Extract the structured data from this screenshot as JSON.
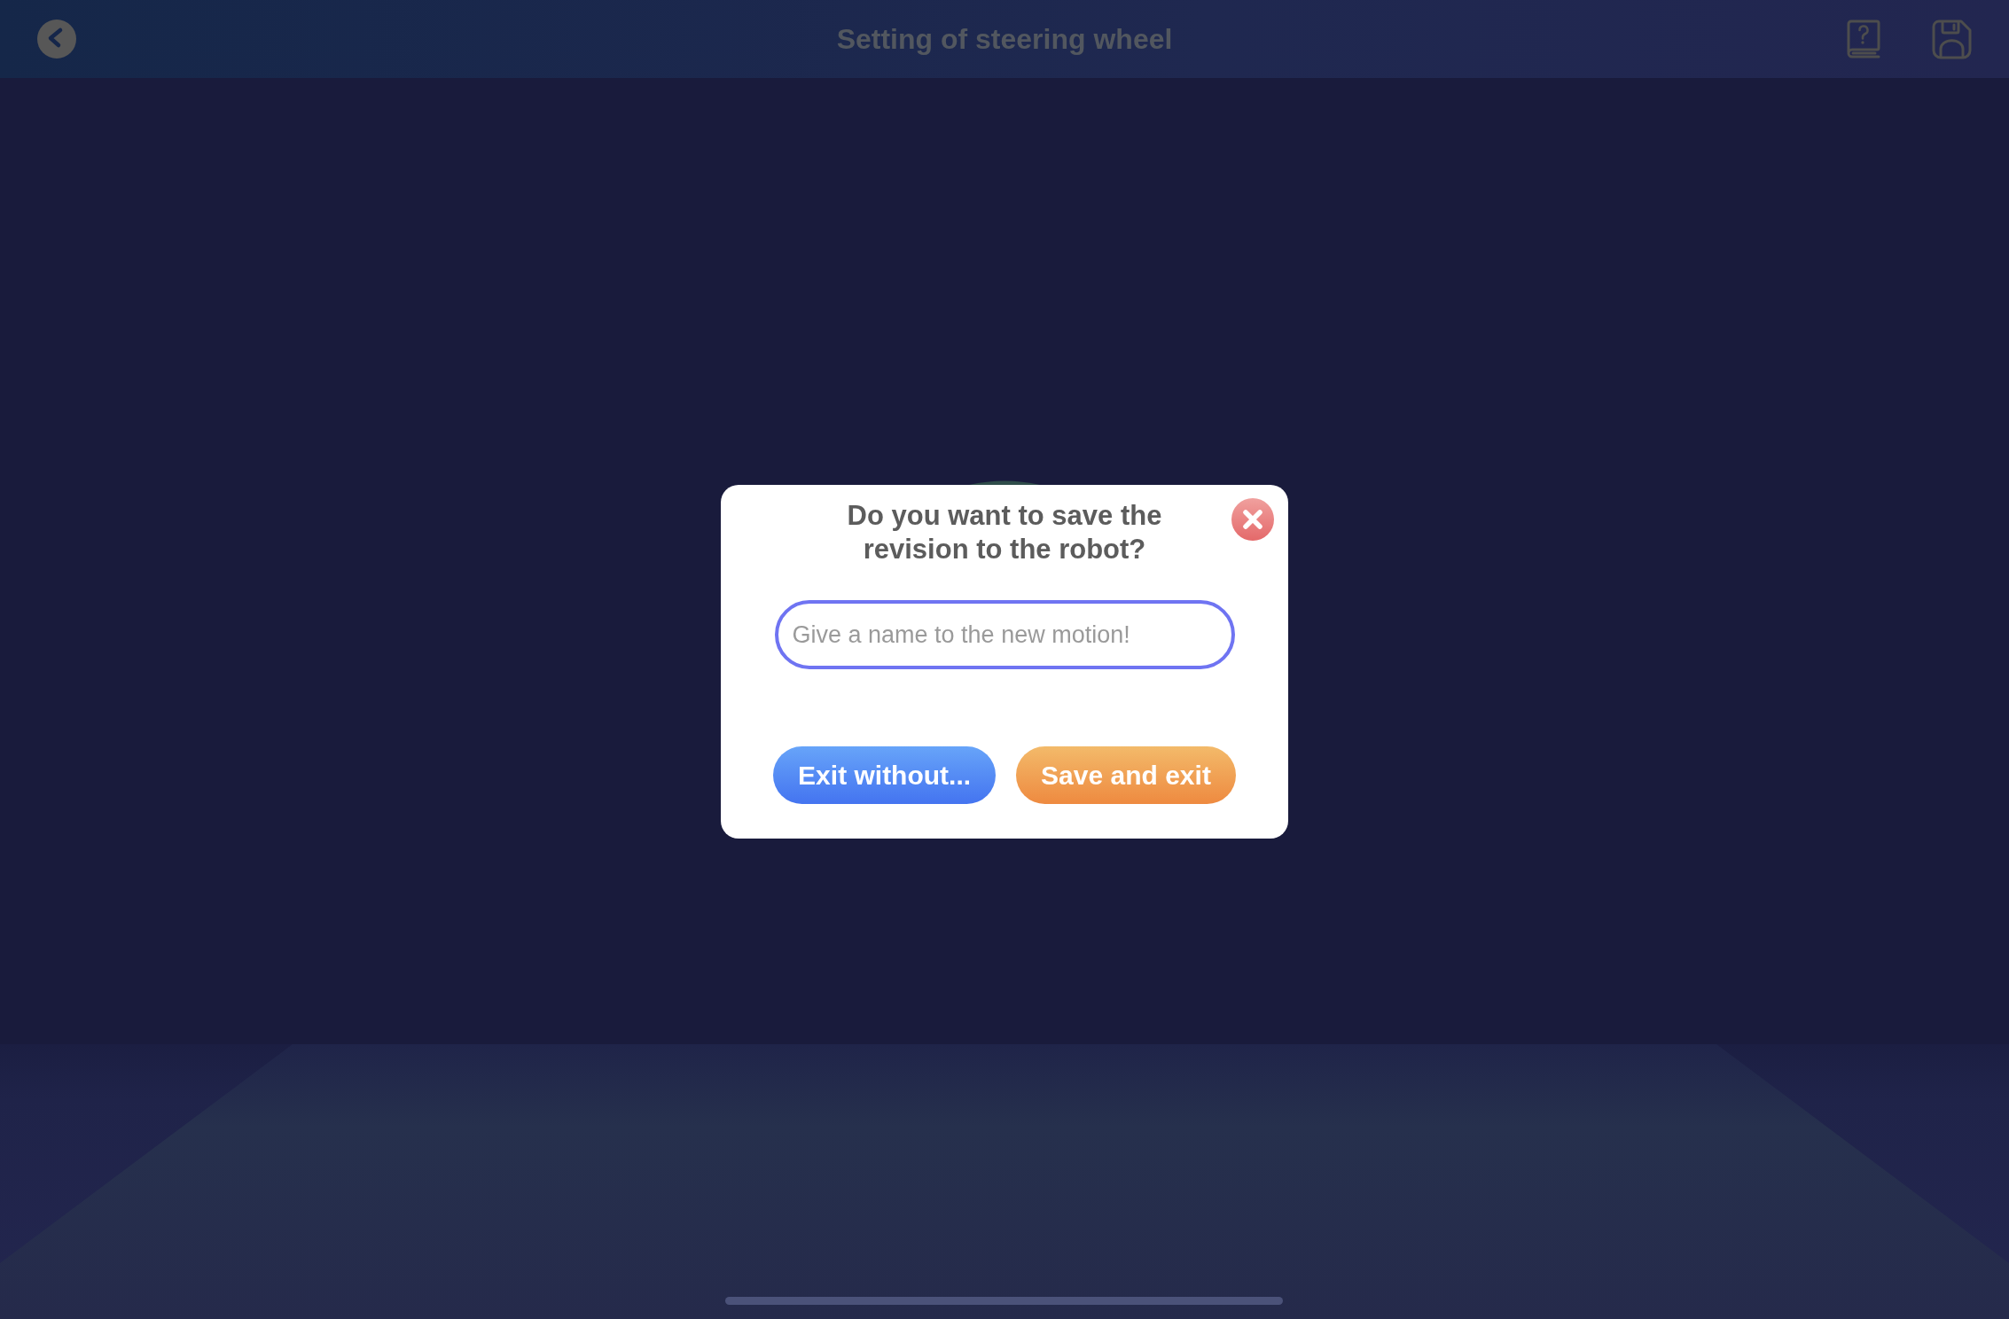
{
  "top_bar": {
    "title": "Setting of steering wheel"
  },
  "dialog": {
    "title": "Do you want to save the revision to the robot?",
    "name_field": {
      "placeholder": "Give a name to the new motion!"
    },
    "buttons": [
      {
        "label": "Exit without...",
        "kind": "secondary"
      },
      {
        "label": "Save and exit",
        "kind": "primary"
      }
    ]
  }
}
